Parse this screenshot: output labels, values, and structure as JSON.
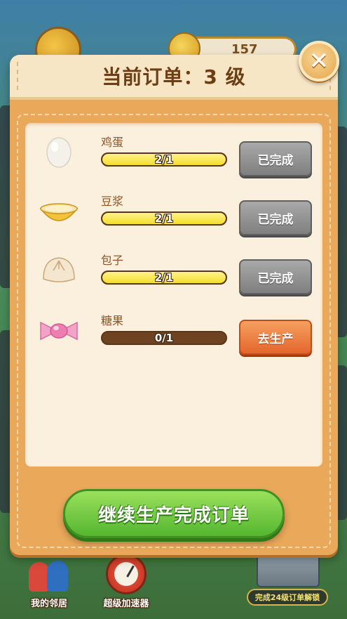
{
  "background": {
    "coin_count": "157"
  },
  "modal": {
    "title": "当前订单：3 级",
    "close_icon": "close-x-icon",
    "continue_button": "继续生产完成订单"
  },
  "orders": [
    {
      "name": "鸡蛋",
      "progress_text": "2/1",
      "progress": 1.0,
      "status": "已完成",
      "icon": "egg-icon"
    },
    {
      "name": "豆浆",
      "progress_text": "2/1",
      "progress": 1.0,
      "status": "已完成",
      "icon": "soy-milk-bowl-icon"
    },
    {
      "name": "包子",
      "progress_text": "2/1",
      "progress": 1.0,
      "status": "已完成",
      "icon": "steamed-bun-icon"
    },
    {
      "name": "糖果",
      "progress_text": "0/1",
      "progress": 0.0,
      "status": "去生产",
      "icon": "candy-icon"
    }
  ],
  "bottom_bar": {
    "neighbors_label": "我的邻居",
    "booster_label": "超级加速器",
    "unlock_text": "完成24级订单解锁"
  },
  "colors": {
    "modal_bg": "#e9a85a",
    "panel_bg": "#fbf0dd",
    "done_button": "#8f8f8f",
    "produce_button": "#e4662c",
    "continue_button": "#54b630"
  }
}
